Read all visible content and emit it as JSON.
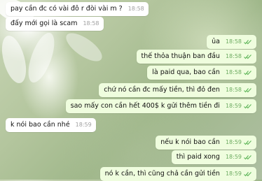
{
  "messages": [
    {
      "dir": "in",
      "text": "pay cần đc có vài đô r đòi vài m ?",
      "time": "18:58"
    },
    {
      "dir": "in",
      "text": "đấy mới gọi là scam",
      "time": "18:58"
    },
    {
      "dir": "out",
      "text": "ủa",
      "time": "18:58",
      "read": true
    },
    {
      "dir": "out",
      "text": "thế thỏa thuận ban đầu",
      "time": "18:58",
      "read": true
    },
    {
      "dir": "out",
      "text": "là paid qua, bao cần",
      "time": "18:58",
      "read": true
    },
    {
      "dir": "out",
      "text": "chứ nó cần đc mấy tiền, thì đỏ đen",
      "time": "18:58",
      "read": true
    },
    {
      "dir": "out",
      "text": "sao mấy con cần hết 400$ k gửi thêm tiền đi",
      "time": "18:59",
      "read": true
    },
    {
      "dir": "in",
      "text": "k nói bao cần nhé",
      "time": "18:59"
    },
    {
      "dir": "out",
      "text": "nếu k nói bao cần",
      "time": "18:59",
      "read": true
    },
    {
      "dir": "out",
      "text": "thì paid xong",
      "time": "18:59",
      "read": true
    },
    {
      "dir": "out",
      "text": "nó k cần, thì cũng chả cần gửi tiền",
      "time": "18:59",
      "read": true
    }
  ],
  "colors": {
    "incoming": "#ffffff",
    "outgoing": "#effdde",
    "check": "#5fb65a"
  },
  "icons": {
    "read_receipt": "double-check-icon"
  }
}
